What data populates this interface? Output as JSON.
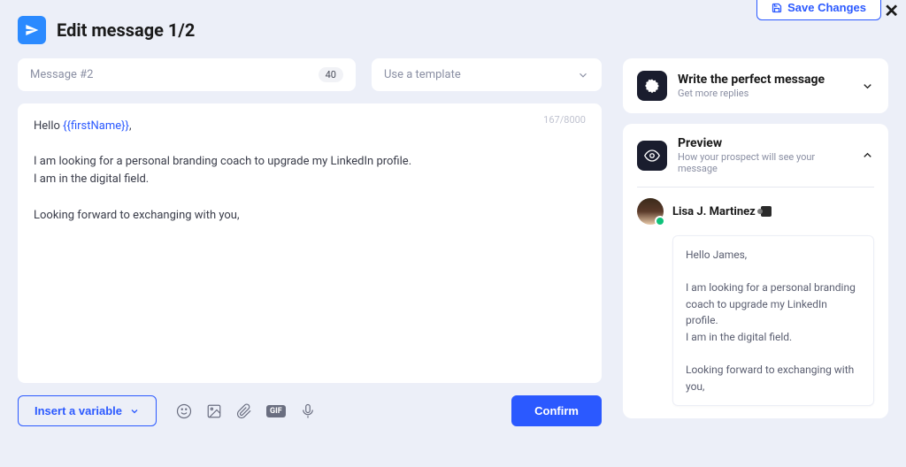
{
  "header": {
    "save_changes": "Save Changes",
    "title": "Edit message 1/2"
  },
  "message_input": {
    "label": "Message #2",
    "counter": "40"
  },
  "template_select": {
    "label": "Use a template"
  },
  "editor": {
    "char_counter": "167/8000",
    "greeting_prefix": "Hello ",
    "variable": "{{firstName}}",
    "greeting_suffix": ",",
    "body": "I am looking for a personal branding coach to upgrade my LinkedIn profile.\nI am in the digital field.\n\nLooking forward to exchanging with you,"
  },
  "bottom": {
    "insert_variable": "Insert a variable",
    "confirm": "Confirm"
  },
  "side": {
    "write": {
      "title": "Write the perfect message",
      "sub": "Get more replies"
    },
    "preview": {
      "title": "Preview",
      "sub": "How your prospect will see your message",
      "person_name": "Lisa J. Martinez",
      "bubble": "Hello James,\n\nI am looking for a personal branding coach to upgrade my LinkedIn profile.\nI am in the digital field.\n\nLooking forward to exchanging with you,"
    }
  }
}
